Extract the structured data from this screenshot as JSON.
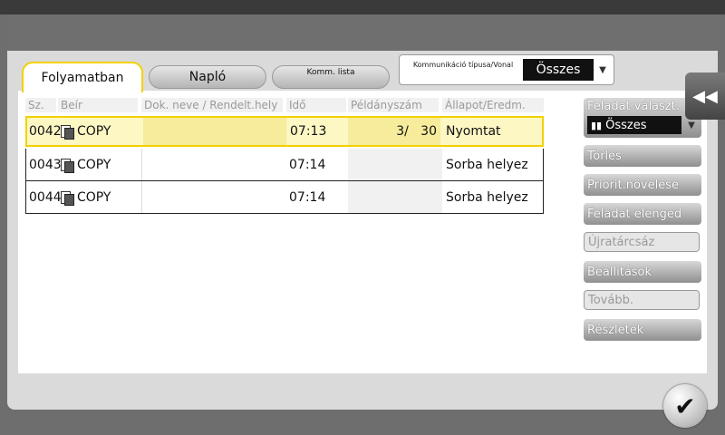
{
  "tabs": {
    "active": "Folyamatban",
    "naplo": "Napló",
    "komm": "Komm. lista"
  },
  "comm_filter": {
    "label": "Kommunikáció típusa/Vonal",
    "value": "Összes"
  },
  "table": {
    "headers": [
      "Sz.",
      "Beír",
      "Dok. neve / Rendelt.hely",
      "Idő",
      "Példányszám",
      "Állapot/Eredm."
    ],
    "rows": [
      {
        "no": "0042",
        "type": "COPY",
        "doc": "",
        "time": "07:13",
        "copies": "3/   30",
        "status": "Nyomtat"
      },
      {
        "no": "0043",
        "type": "COPY",
        "doc": "",
        "time": "07:14",
        "copies": "",
        "status": "Sorba helyez"
      },
      {
        "no": "0044",
        "type": "COPY",
        "doc": "",
        "time": "07:14",
        "copies": "",
        "status": "Sorba helyez"
      }
    ]
  },
  "side": {
    "job_select_label": "Feladat választ.",
    "job_select_value": "Összes",
    "buttons": [
      "Törlés",
      "Priorit.növelése",
      "Feladat elenged",
      "Újratárcsáz",
      "Beállítások",
      "Tovább.",
      "Részletek"
    ]
  },
  "icons": {
    "collapse": "double-chevron-left-icon",
    "ok": "checkmark-icon",
    "doc": "document-icon"
  }
}
